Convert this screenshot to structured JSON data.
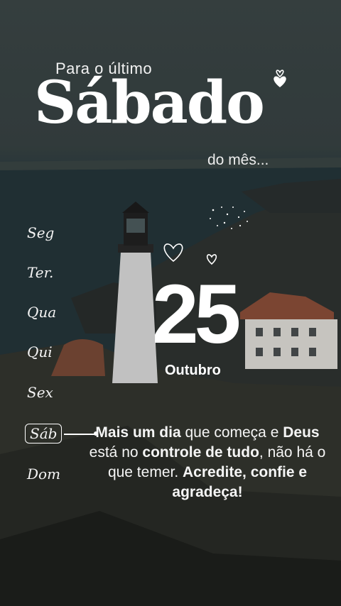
{
  "header": {
    "pre_title": "Para o último",
    "title": "Sábado",
    "sub_title": "do mês..."
  },
  "weekdays": {
    "mon": "Seg",
    "tue": "Ter.",
    "wed": "Qua",
    "thu": "Qui",
    "fri": "Sex",
    "sat": "Sáb",
    "sun": "Dom",
    "selected": "Sáb"
  },
  "date": {
    "day": "25",
    "month": "Outubro"
  },
  "message": {
    "p1_bold": "Mais um dia",
    "p2": " que começa e ",
    "p3_bold": "Deus",
    "p4": " está no ",
    "p5_bold": "controle de tudo",
    "p6": ", não há o que temer. ",
    "p7_bold": "Acredite, confie e agradeça!"
  },
  "icons": [
    "heart-icon",
    "heart-icon",
    "heart-icon",
    "heart-icon"
  ]
}
